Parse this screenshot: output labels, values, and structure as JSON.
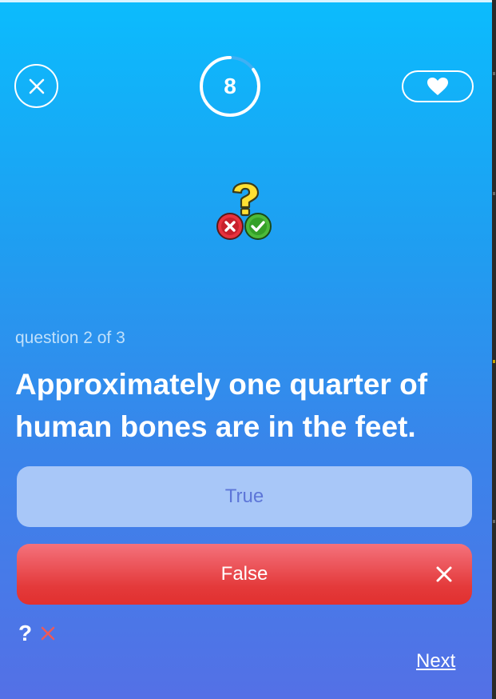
{
  "header": {
    "close_icon": "close-icon",
    "timer_value": "8",
    "timer_progress": 0.85,
    "heart_icon": "heart-icon"
  },
  "illustration": {
    "icon": "quiz-true-false-icon"
  },
  "quiz": {
    "counter": "question 2 of 3",
    "question": "Approximately one quarter of human bones are in the feet."
  },
  "answers": {
    "true_label": "True",
    "false_label": "False",
    "false_status_icon": "x-icon"
  },
  "progress": {
    "marks": [
      "?",
      "✕"
    ]
  },
  "footer": {
    "next_label": "Next"
  },
  "colors": {
    "background_top": "#0bbcfd",
    "background_bottom": "#5470e6",
    "answer_neutral": "#a8c7f8",
    "answer_wrong": "#e43a3b",
    "wrong_mark": "#ec5a5a"
  }
}
